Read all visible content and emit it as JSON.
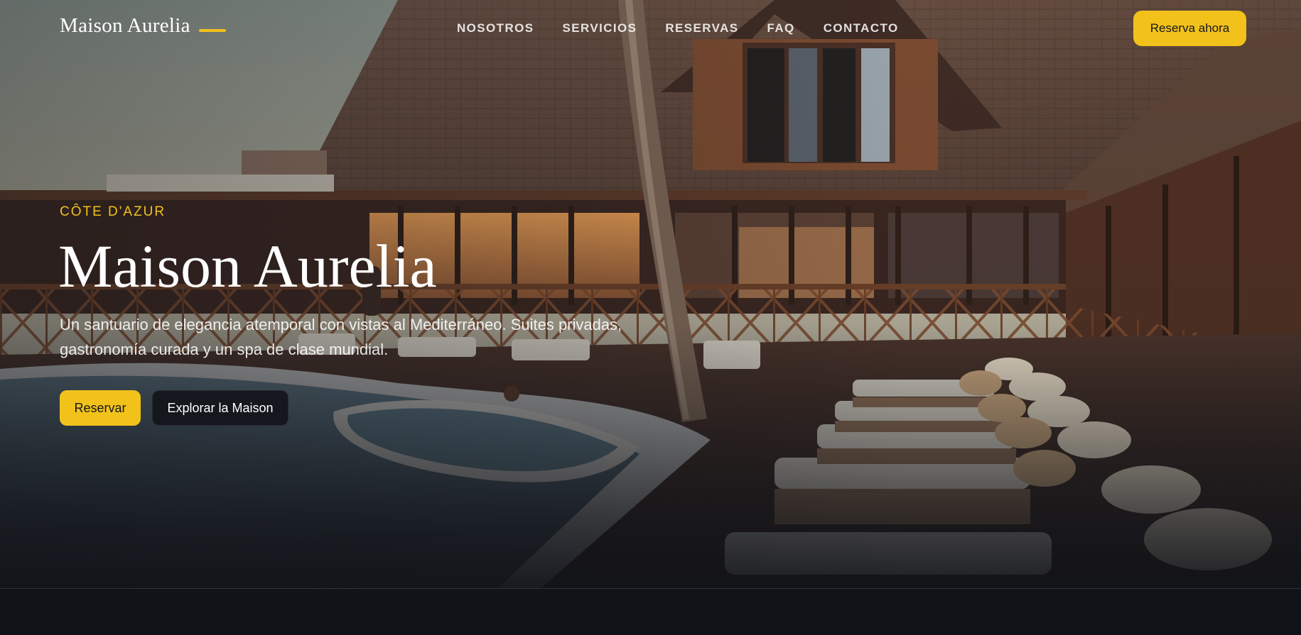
{
  "brand": {
    "name": "Maison Aurelia",
    "accent_color": "#f2c21b"
  },
  "nav": {
    "items": [
      "NOSOTROS",
      "SERVICIOS",
      "RESERVAS",
      "FAQ",
      "CONTACTO"
    ]
  },
  "header": {
    "cta_label": "Reserva ahora"
  },
  "hero": {
    "eyebrow": "CÔTE D'AZUR",
    "title": "Maison Aurelia",
    "subtitle": "Un santuario de elegancia atemporal con vistas al Mediterráneo. Suites privadas, gastronomía curada y un spa de clase mundial.",
    "primary_button": "Reservar",
    "secondary_button": "Explorar la Maison"
  }
}
